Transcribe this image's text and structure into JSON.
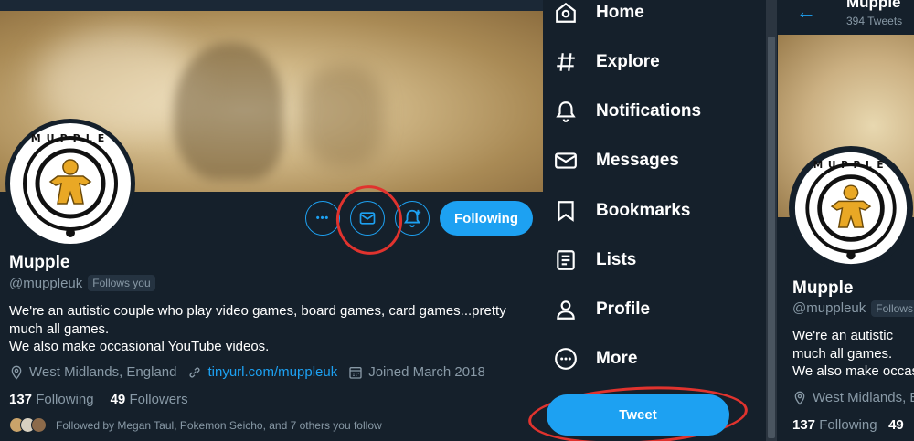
{
  "profile": {
    "name": "Mupple",
    "handle": "@muppleuk",
    "follows_you": "Follows you",
    "bio_line1": "We're an autistic couple who play video games, board games, card games...pretty",
    "bio_line2": "much all games.",
    "bio_line3": "We also make occasional YouTube videos.",
    "location": "West Midlands, England",
    "link": "tinyurl.com/muppleuk",
    "joined": "Joined March 2018",
    "following_count": "137",
    "following_label": "Following",
    "followers_count": "49",
    "followers_label": "Followers",
    "followed_by": "Followed by Megan Taul, Pokemon Seicho, and 7 others you follow",
    "logo_text": "MUPPLE"
  },
  "actions": {
    "more_glyph": "•••",
    "following_button": "Following"
  },
  "nav": {
    "items": [
      {
        "label": "Home",
        "icon": "home-icon"
      },
      {
        "label": "Explore",
        "icon": "hashtag-icon"
      },
      {
        "label": "Notifications",
        "icon": "bell-icon"
      },
      {
        "label": "Messages",
        "icon": "mail-icon"
      },
      {
        "label": "Bookmarks",
        "icon": "bookmark-icon"
      },
      {
        "label": "Lists",
        "icon": "list-icon"
      },
      {
        "label": "Profile",
        "icon": "person-icon"
      },
      {
        "label": "More",
        "icon": "more-circle-icon"
      }
    ],
    "tweet_button": "Tweet"
  },
  "right_panel": {
    "header_name": "Mupple",
    "header_count": "394 Tweets",
    "back_arrow": "←",
    "name": "Mupple",
    "handle": "@muppleuk",
    "follows_badge": "Follows",
    "bio_line1": "We're an autistic",
    "bio_line2": "much all games.",
    "bio_line3": "We also make occas",
    "location": "West Midlands, E",
    "following_count": "137",
    "following_label": "Following",
    "followers_count": "49"
  },
  "colors": {
    "background": "#15202b",
    "accent": "#1da1f2",
    "annotation_red": "#e0332e",
    "muted_text": "#8899a6"
  }
}
